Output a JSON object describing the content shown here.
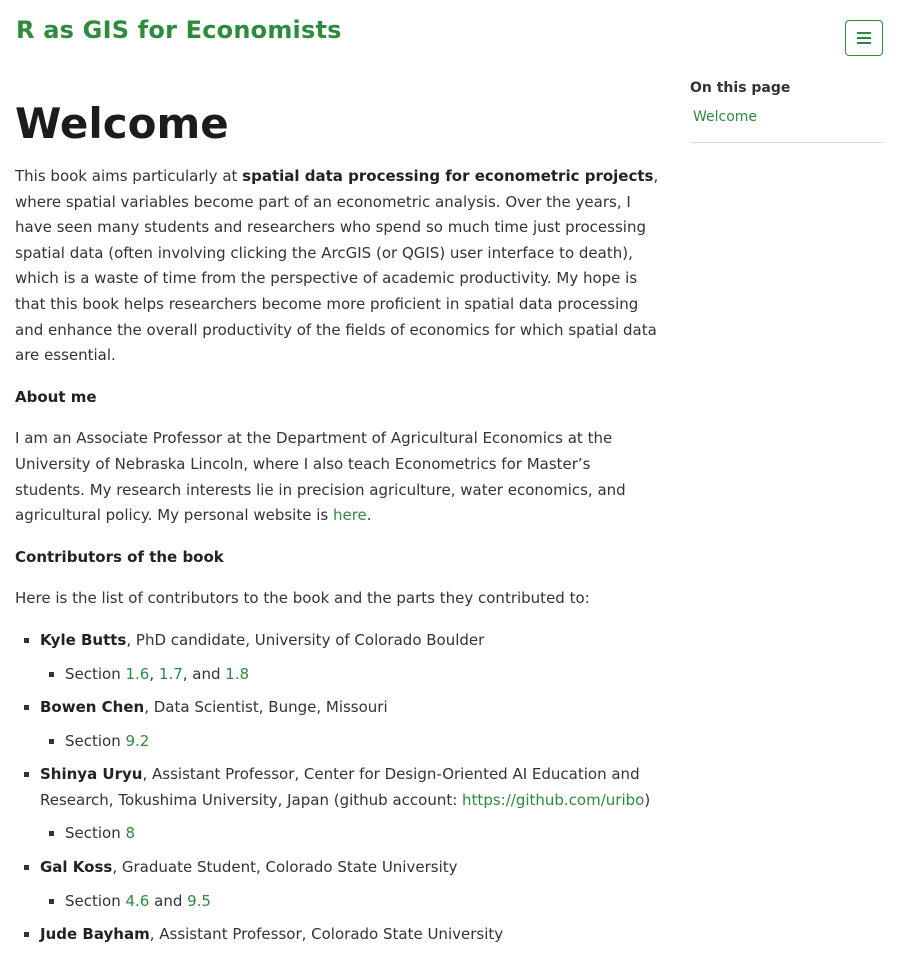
{
  "header": {
    "site_title": "R as GIS for Economists"
  },
  "toc": {
    "title": "On this page",
    "items": [
      "Welcome"
    ]
  },
  "main": {
    "title": "Welcome",
    "intro": {
      "before": "This book aims particularly at ",
      "bold": "spatial data processing for econometric projects",
      "after": ", where spatial variables become part of an econometric analysis. Over the years, I have seen many students and researchers who spend so much time just processing spatial data (often involving clicking the ArcGIS (or QGIS) user interface to death), which is a waste of time from the perspective of academic productivity. My hope is that this book helps researchers become more proficient in spatial data processing and enhance the overall productivity of the fields of economics for which spatial data are essential."
    },
    "about_heading": "About me",
    "about": {
      "text": "I am an Associate Professor at the Department of Agricultural Economics at the University of Nebraska Lincoln, where I also teach Econometrics for Master’s students. My research interests lie in precision agriculture, water economics, and agricultural policy. My personal website is ",
      "link": "here",
      "end": "."
    },
    "contributors_heading": "Contributors of the book",
    "contributors_intro": "Here is the list of contributors to the book and the parts they contributed to:",
    "contributors": [
      {
        "name": "Kyle Butts",
        "desc": ", PhD candidate, University of Colorado Boulder",
        "section_prefix": "Section ",
        "sec1": "1.6",
        "sep1": ", ",
        "sec2": "1.7",
        "sep2": ", and ",
        "sec3": "1.8"
      },
      {
        "name": "Bowen Chen",
        "desc": ", Data Scientist, Bunge, Missouri",
        "section_prefix": "Section ",
        "sec1": "9.2"
      },
      {
        "name": "Shinya Uryu",
        "desc": ", Assistant Professor, Center for Design-Oriented AI Education and Research, Tokushima University, Japan (github account: ",
        "link": "https://github.com/uribo",
        "desc_end": ")",
        "section_prefix": "Section ",
        "sec1": "8"
      },
      {
        "name": "Gal Koss",
        "desc": ", Graduate Student, Colorado State University",
        "section_prefix": "Section ",
        "sec1": "4.6",
        "sep1": " and ",
        "sec2": "9.5"
      },
      {
        "name": "Jude Bayham",
        "desc": ", Assistant Professor, Colorado State University"
      }
    ]
  },
  "colors": {
    "accent": "#2e8b3e",
    "text": "#333333",
    "divider": "#dcdcdc"
  },
  "icons": {
    "menu": "hamburger-menu-icon"
  }
}
